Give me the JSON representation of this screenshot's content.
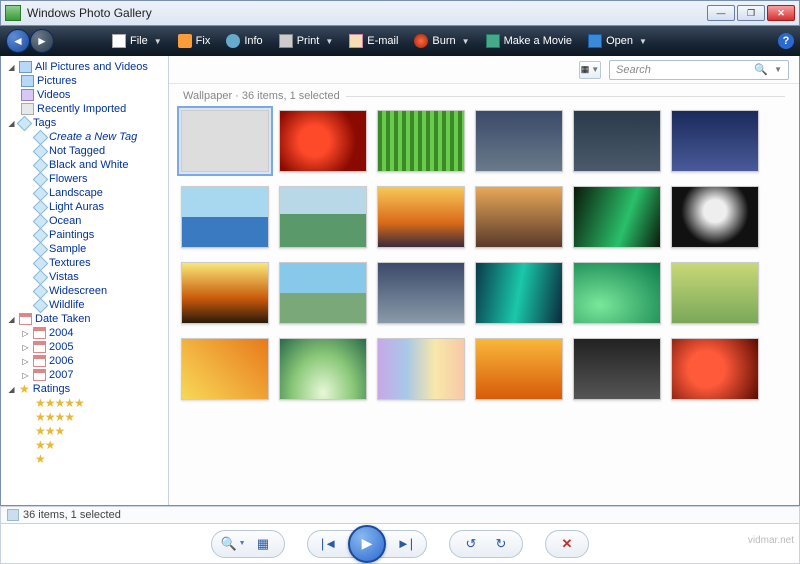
{
  "window": {
    "title": "Windows Photo Gallery"
  },
  "toolbar": {
    "file": "File",
    "fix": "Fix",
    "info": "Info",
    "print": "Print",
    "email": "E-mail",
    "burn": "Burn",
    "movie": "Make a Movie",
    "open": "Open"
  },
  "sidebar": {
    "root": "All Pictures and Videos",
    "pictures": "Pictures",
    "videos": "Videos",
    "recent": "Recently Imported",
    "tags_label": "Tags",
    "create_tag": "Create a New Tag",
    "tags": [
      "Not Tagged",
      "Black and White",
      "Flowers",
      "Landscape",
      "Light Auras",
      "Ocean",
      "Paintings",
      "Sample",
      "Textures",
      "Vistas",
      "Widescreen",
      "Wildlife"
    ],
    "date_label": "Date Taken",
    "dates": [
      "2004",
      "2005",
      "2006",
      "2007"
    ],
    "ratings_label": "Ratings"
  },
  "search": {
    "placeholder": "Search"
  },
  "gallery": {
    "breadcrumb": "Wallpaper · 36 items, 1 selected",
    "count": 36,
    "selected_index": 0
  },
  "status": {
    "text": "36 items, 1 selected"
  },
  "watermark": "vidmar.net"
}
